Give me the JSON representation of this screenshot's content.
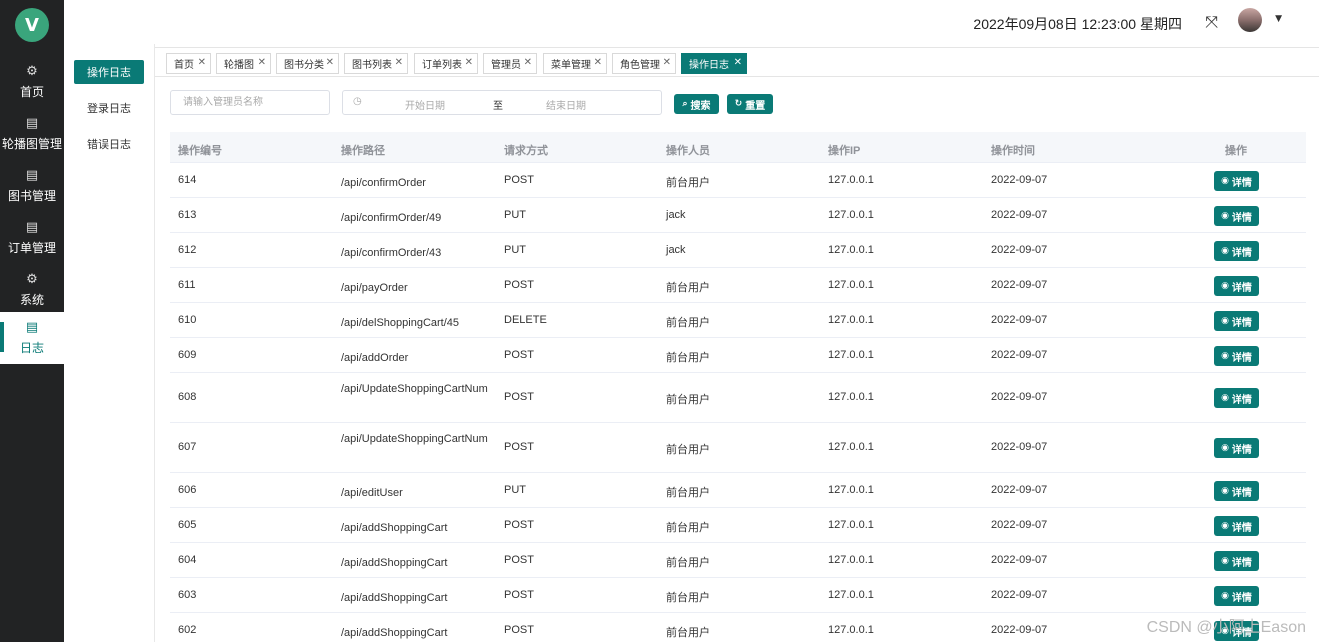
{
  "logo": "V",
  "rail": [
    {
      "label": "首页",
      "icon": "gear-icon"
    },
    {
      "label": "轮播图管理",
      "icon": "clipboard-icon"
    },
    {
      "label": "图书管理",
      "icon": "clipboard-icon"
    },
    {
      "label": "订单管理",
      "icon": "clipboard-icon"
    },
    {
      "label": "系统",
      "icon": "gear-icon"
    },
    {
      "label": "日志",
      "icon": "clipboard-icon"
    }
  ],
  "submenu": [
    "操作日志",
    "登录日志",
    "错误日志"
  ],
  "header": {
    "datetime": "2022年09月08日 12:23:00 星期四",
    "fullscreen_icon": "fullscreen-icon",
    "caret_icon": "caret-down-icon"
  },
  "tabs": [
    "首页",
    "轮播图",
    "图书分类",
    "图书列表",
    "订单列表",
    "管理员",
    "菜单管理",
    "角色管理",
    "操作日志"
  ],
  "search": {
    "name_placeholder": "请输入管理员名称",
    "start_placeholder": "开始日期",
    "separator": "至",
    "end_placeholder": "结束日期",
    "search_label": "搜索",
    "reset_label": "重置"
  },
  "table": {
    "headers": [
      "操作编号",
      "操作路径",
      "请求方式",
      "操作人员",
      "操作IP",
      "操作时间",
      "操作"
    ],
    "detail_label": "详情",
    "rows": [
      [
        "614",
        "/api/confirmOrder",
        "POST",
        "前台用户",
        "127.0.0.1",
        "2022-09-07"
      ],
      [
        "613",
        "/api/confirmOrder/49",
        "PUT",
        "jack",
        "127.0.0.1",
        "2022-09-07"
      ],
      [
        "612",
        "/api/confirmOrder/43",
        "PUT",
        "jack",
        "127.0.0.1",
        "2022-09-07"
      ],
      [
        "611",
        "/api/payOrder",
        "POST",
        "前台用户",
        "127.0.0.1",
        "2022-09-07"
      ],
      [
        "610",
        "/api/delShoppingCart/45",
        "DELETE",
        "前台用户",
        "127.0.0.1",
        "2022-09-07"
      ],
      [
        "609",
        "/api/addOrder",
        "POST",
        "前台用户",
        "127.0.0.1",
        "2022-09-07"
      ],
      [
        "608",
        "/api/UpdateShoppingCartNum",
        "POST",
        "前台用户",
        "127.0.0.1",
        "2022-09-07"
      ],
      [
        "607",
        "/api/UpdateShoppingCartNum",
        "POST",
        "前台用户",
        "127.0.0.1",
        "2022-09-07"
      ],
      [
        "606",
        "/api/editUser",
        "PUT",
        "前台用户",
        "127.0.0.1",
        "2022-09-07"
      ],
      [
        "605",
        "/api/addShoppingCart",
        "POST",
        "前台用户",
        "127.0.0.1",
        "2022-09-07"
      ],
      [
        "604",
        "/api/addShoppingCart",
        "POST",
        "前台用户",
        "127.0.0.1",
        "2022-09-07"
      ],
      [
        "603",
        "/api/addShoppingCart",
        "POST",
        "前台用户",
        "127.0.0.1",
        "2022-09-07"
      ],
      [
        "602",
        "/api/addShoppingCart",
        "POST",
        "前台用户",
        "127.0.0.1",
        "2022-09-07"
      ]
    ]
  },
  "watermark": "CSDN @小阿上Eason",
  "colors": {
    "accent": "#0a7a76",
    "rail_bg": "#222324",
    "logo": "#3aa57c"
  }
}
